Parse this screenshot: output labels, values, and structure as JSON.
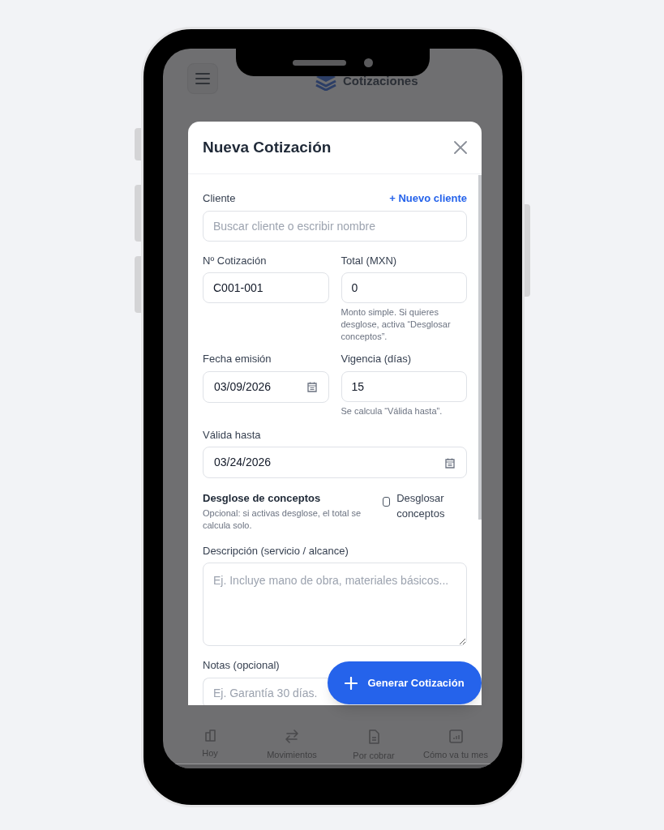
{
  "app_header": {
    "title": "Cotizaciones"
  },
  "modal": {
    "title": "Nueva Cotización",
    "client": {
      "label": "Cliente",
      "link": "+ Nuevo cliente",
      "placeholder": "Buscar cliente o escribir nombre"
    },
    "quote_number": {
      "label": "Nº Cotización",
      "value": "C001-001"
    },
    "total": {
      "label": "Total (MXN)",
      "value": "0",
      "hint": "Monto simple. Si quieres desglose, activa “Desglosar conceptos”."
    },
    "issue_date": {
      "label": "Fecha emisión",
      "value": "03/09/2026"
    },
    "validity": {
      "label": "Vigencia (días)",
      "value": "15",
      "hint": "Se calcula “Válida hasta”."
    },
    "valid_until": {
      "label": "Válida hasta",
      "value": "03/24/2026"
    },
    "breakdown": {
      "title": "Desglose de conceptos",
      "hint": "Opcional: si activas desglose, el total se calcula solo.",
      "checkbox": {
        "label": "Desglosar conceptos",
        "checked": false
      }
    },
    "description": {
      "label": "Descripción (servicio / alcance)",
      "placeholder": "Ej. Incluye mano de obra, materiales básicos..."
    },
    "notes": {
      "label": "Notas (opcional)",
      "placeholder": "Ej. Garantía 30 días."
    }
  },
  "fab": {
    "label": "Generar Cotización"
  },
  "bottom_nav": [
    {
      "label": "Hoy"
    },
    {
      "label": "Movimientos"
    },
    {
      "label": "Por cobrar"
    },
    {
      "label": "Cómo va tu mes"
    }
  ]
}
